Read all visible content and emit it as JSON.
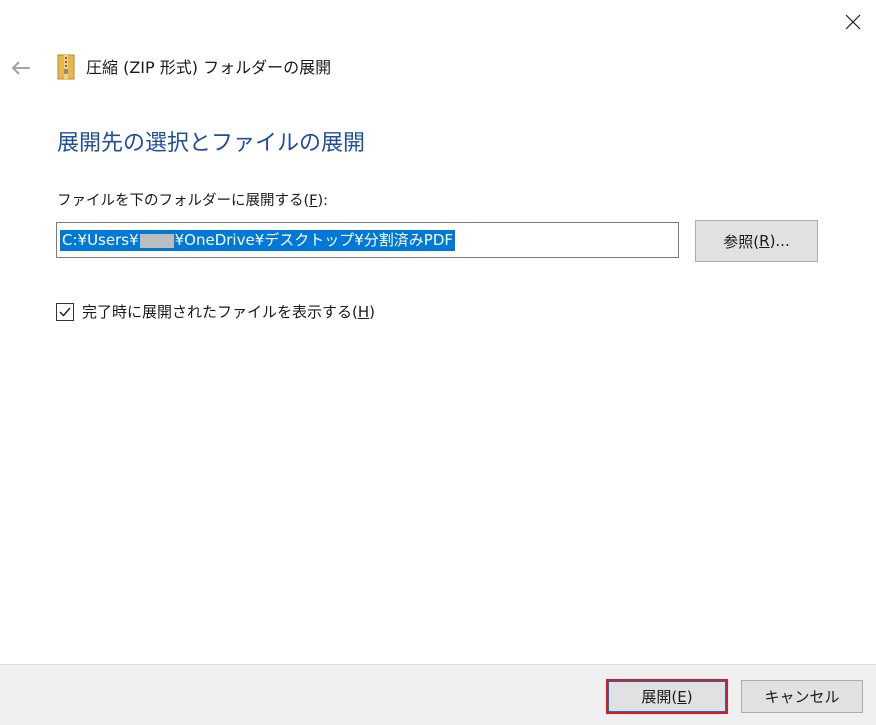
{
  "window": {
    "title": "圧縮 (ZIP 形式) フォルダーの展開",
    "icons": {
      "close": "close-icon",
      "back": "back-arrow-icon",
      "zip": "zip-folder-icon"
    }
  },
  "main": {
    "heading": "展開先の選択とファイルの展開",
    "path_label_prefix": "ファイルを下のフォルダーに展開する(",
    "path_label_key": "F",
    "path_label_suffix": "):",
    "path_value_part1": "C:¥Users¥",
    "path_value_part2": "¥OneDrive¥デスクトップ¥分割済みPDF",
    "browse_prefix": "参照(",
    "browse_key": "R",
    "browse_suffix": ")...",
    "show_files_checked": true,
    "show_files_prefix": "完了時に展開されたファイルを表示する(",
    "show_files_key": "H",
    "show_files_suffix": ")"
  },
  "footer": {
    "extract_prefix": "展開(",
    "extract_key": "E",
    "extract_suffix": ")",
    "cancel_label": "キャンセル"
  },
  "colors": {
    "heading": "#1f4e9c",
    "selection": "#0078d7",
    "highlight_border": "#e3161b"
  }
}
